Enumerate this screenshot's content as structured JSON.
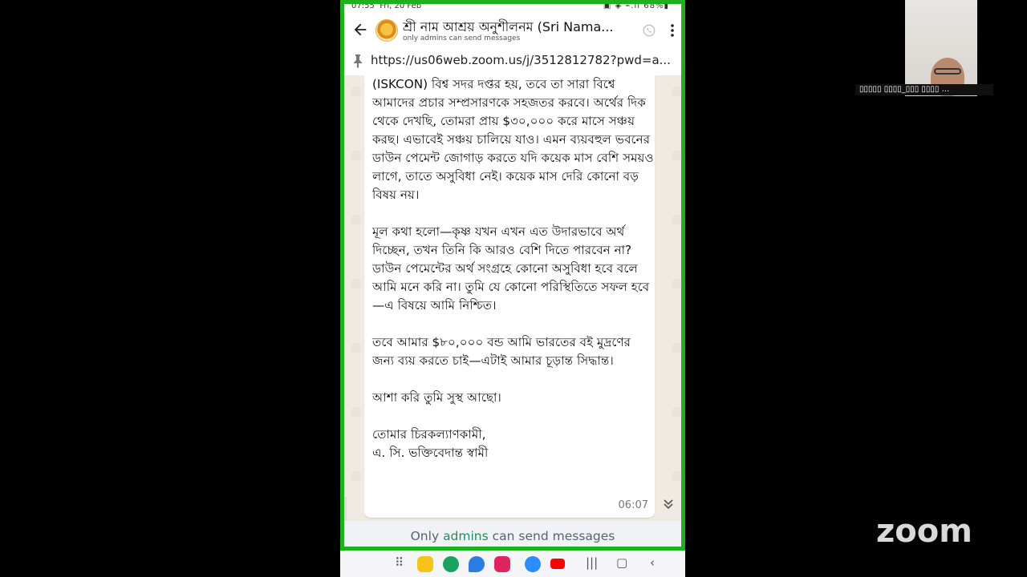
{
  "statusbar": {
    "time": "07:55",
    "date": "Fri, 20 Feb",
    "battery": "68%"
  },
  "chat": {
    "title": "শ্রী নাম আশ্রয় অনুশীলনম (Sri Nama...",
    "subtitle": "only admins can send messages",
    "pinned_link": "https://us06web.zoom.us/j/3512812782?pwd=a..."
  },
  "message": {
    "paragraphs": [
      "(ISKCON) বিশ্ব সদর দপ্তর হয়, তবে তা সারা বিশ্বে আমাদের প্রচার সম্প্রসারণকে সহজতর করবে। অর্থের দিক থেকে দেখছি, তোমরা প্রায় $৩০,০০০ করে মাসে সঞ্চয় করছ। এভাবেই সঞ্চয় চালিয়ে যাও। এমন ব্যয়বহুল ভবনের ডাউন পেমেন্ট জোগাড় করতে যদি কয়েক মাস বেশি সময়ও লাগে, তাতে অসুবিধা নেই। কয়েক মাস দেরি কোনো বড় বিষয় নয়।",
      "মূল কথা হলো—কৃষ্ণ যখন এখন এত উদারভাবে অর্থ দিচ্ছেন, তখন তিনি কি আরও বেশি দিতে পারবেন না? ডাউন পেমেন্টের অর্থ সংগ্রহে কোনো অসুবিধা হবে বলে আমি মনে করি না। তুমি যে কোনো পরিস্থিতিতে সফল হবে—এ বিষয়ে আমি নিশ্চিত।",
      "তবে আমার $৮০,০০০ বন্ড আমি ভারতের বই মুদ্রণের জন্য ব্যয় করতে চাই—এটাই আমার চূড়ান্ত সিদ্ধান্ত।",
      "আশা করি তুমি সুস্থ আছো।"
    ],
    "closing": "তোমার চিরকল্যাণকামী,",
    "signature": "এ. সি. ভক্তিবেদান্ত স্বামী",
    "time": "06:07"
  },
  "admin_bar": {
    "prefix": "Only",
    "link": "admins",
    "suffix": "can send messages"
  },
  "zoom": {
    "participant_name": "▯▯▯▯▯ ▯▯▯▯_▯▯▯ ▯▯▯▯ ...",
    "logo": "zoom"
  },
  "colors": {
    "share_border": "#1db21d",
    "admin_link": "#1f8f5e",
    "chat_bg": "#efeae2"
  },
  "icons": [
    "back-arrow-icon",
    "group-avatar",
    "call-icon",
    "more-vert-icon",
    "pin-icon",
    "scroll-down-icon"
  ]
}
